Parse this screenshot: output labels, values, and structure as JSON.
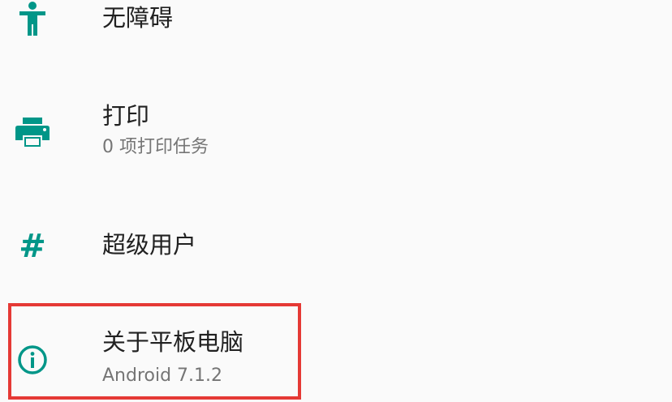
{
  "settings": {
    "items": [
      {
        "title": "无障碍",
        "summary": "",
        "icon": "accessibility-icon"
      },
      {
        "title": "打印",
        "summary": "0 项打印任务",
        "icon": "print-icon"
      },
      {
        "title": "超级用户",
        "summary": "",
        "icon": "hash-icon"
      },
      {
        "title": "关于平板电脑",
        "summary": "Android 7.1.2",
        "icon": "info-icon"
      }
    ],
    "hash_glyph": "#"
  },
  "colors": {
    "accent": "#009688",
    "title_text": "#212121",
    "summary_text": "#757575",
    "background": "#fafafa",
    "highlight_border": "#e53935"
  }
}
